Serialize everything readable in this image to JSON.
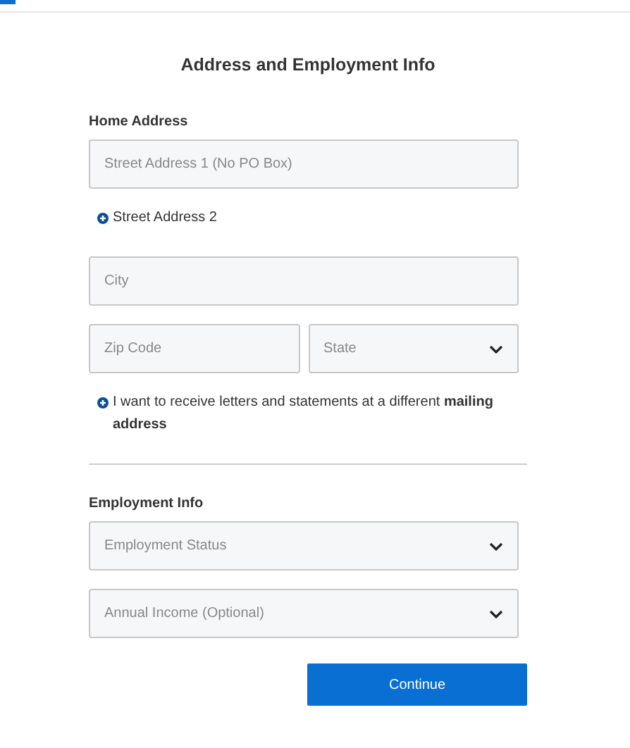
{
  "progress": {
    "level": 0.025
  },
  "title": "Address and Employment Info",
  "sections": [
    {
      "heading": "Home Address",
      "rows": [
        {
          "fields": [
            {
              "kind": "input",
              "placeholder": "Street Address 1 (No PO Box)"
            }
          ]
        },
        {
          "link": "Street Address 2"
        },
        {
          "fields": [
            {
              "kind": "input",
              "placeholder": "City"
            }
          ]
        },
        {
          "fields": [
            {
              "kind": "input",
              "placeholder": "Zip Code"
            },
            {
              "kind": "select",
              "placeholder": "State"
            }
          ]
        },
        {
          "link": "I want to receive letters and statements at a different **mailing address**"
        }
      ]
    },
    {
      "heading": "Employment Info",
      "rows": [
        {
          "fields": [
            {
              "kind": "select",
              "placeholder": "Employment Status"
            }
          ]
        },
        {
          "fields": [
            {
              "kind": "select",
              "placeholder": "Annual Income (Optional)"
            }
          ]
        }
      ]
    }
  ],
  "button": "Continue"
}
